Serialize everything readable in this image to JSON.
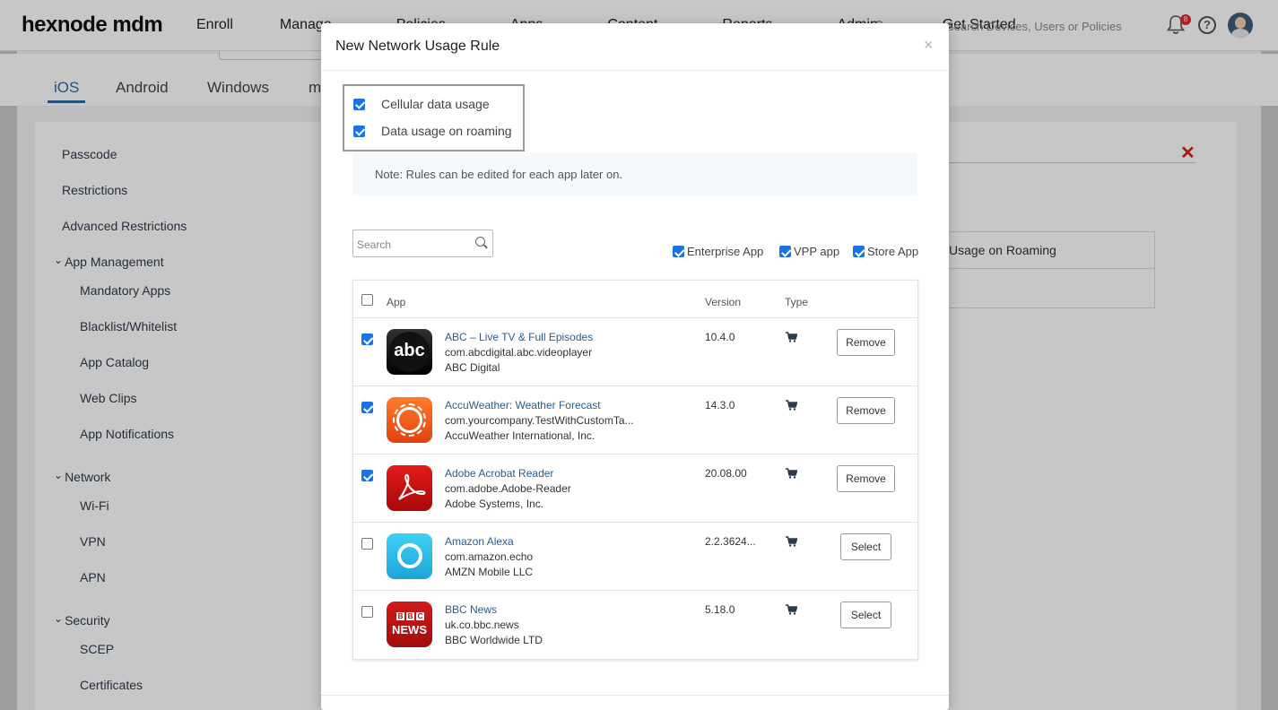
{
  "app": {
    "logo": "hexnode mdm",
    "topnav": [
      "Enroll",
      "Manage",
      "Policies",
      "Apps",
      "Content",
      "Reports",
      "Admin",
      "Get Started"
    ],
    "search_placeholder": "Search Devices, Users or Policies",
    "notifications_count": "8",
    "help_label": "?"
  },
  "platform_tabs": [
    "iOS",
    "Android",
    "Windows",
    "macOS"
  ],
  "sidebar": {
    "items": {
      "passcode": "Passcode",
      "restrictions": "Restrictions",
      "advanced_restrictions": "Advanced Restrictions",
      "app_management": "App Management",
      "mandatory_apps": "Mandatory Apps",
      "blacklist_whitelist": "Blacklist/Whitelist",
      "app_catalog": "App Catalog",
      "web_clips": "Web Clips",
      "app_notifications": "App Notifications",
      "network": "Network",
      "wifi": "Wi-Fi",
      "vpn": "VPN",
      "apn": "APN",
      "security": "Security",
      "scep": "SCEP",
      "certificates": "Certificates"
    }
  },
  "background_table": {
    "header_partial": "Usage on Roaming",
    "remove_icon": "close-x-icon"
  },
  "modal": {
    "title": "New Network Usage Rule",
    "close_glyph": "×",
    "options": [
      {
        "label": "Cellular data usage",
        "checked": true
      },
      {
        "label": "Data usage on roaming",
        "checked": true
      }
    ],
    "note": "Note: Rules can be edited for each app later on.",
    "search_placeholder": "Search",
    "filters": [
      {
        "label": "Enterprise App",
        "checked": true
      },
      {
        "label": "VPP app",
        "checked": true
      },
      {
        "label": "Store App",
        "checked": true
      }
    ],
    "table": {
      "headers": {
        "app": "App",
        "version": "Version",
        "type": "Type"
      },
      "rows": [
        {
          "name": "ABC – Live TV & Full Episodes",
          "bundle": "com.abcdigital.abc.videoplayer",
          "vendor": "ABC Digital",
          "version": "10.4.0",
          "selected": true,
          "action": "Remove",
          "icon": "abc",
          "icon_text": "abc"
        },
        {
          "name": "AccuWeather: Weather Forecast",
          "bundle": "com.yourcompany.TestWithCustomTa...",
          "vendor": "AccuWeather International, Inc.",
          "version": "14.3.0",
          "selected": true,
          "action": "Remove",
          "icon": "accuweather"
        },
        {
          "name": "Adobe Acrobat Reader",
          "bundle": "com.adobe.Adobe-Reader",
          "vendor": "Adobe Systems, Inc.",
          "version": "20.08.00",
          "selected": true,
          "action": "Remove",
          "icon": "adobe"
        },
        {
          "name": "Amazon Alexa",
          "bundle": "com.amazon.echo",
          "vendor": "AMZN Mobile LLC",
          "version": "2.2.3624...",
          "selected": false,
          "action": "Select",
          "icon": "alexa"
        },
        {
          "name": "BBC News",
          "bundle": "uk.co.bbc.news",
          "vendor": "BBC Worldwide LTD",
          "version": "5.18.0",
          "selected": false,
          "action": "Select",
          "icon": "bbc",
          "icon_text_top": [
            "B",
            "B",
            "C"
          ],
          "icon_text": "NEWS"
        }
      ]
    }
  },
  "colors": {
    "accent_blue": "#1a73e8",
    "link_blue": "#2c5d8a",
    "tab_active": "#2e6aa3",
    "danger_red": "#d32020"
  }
}
